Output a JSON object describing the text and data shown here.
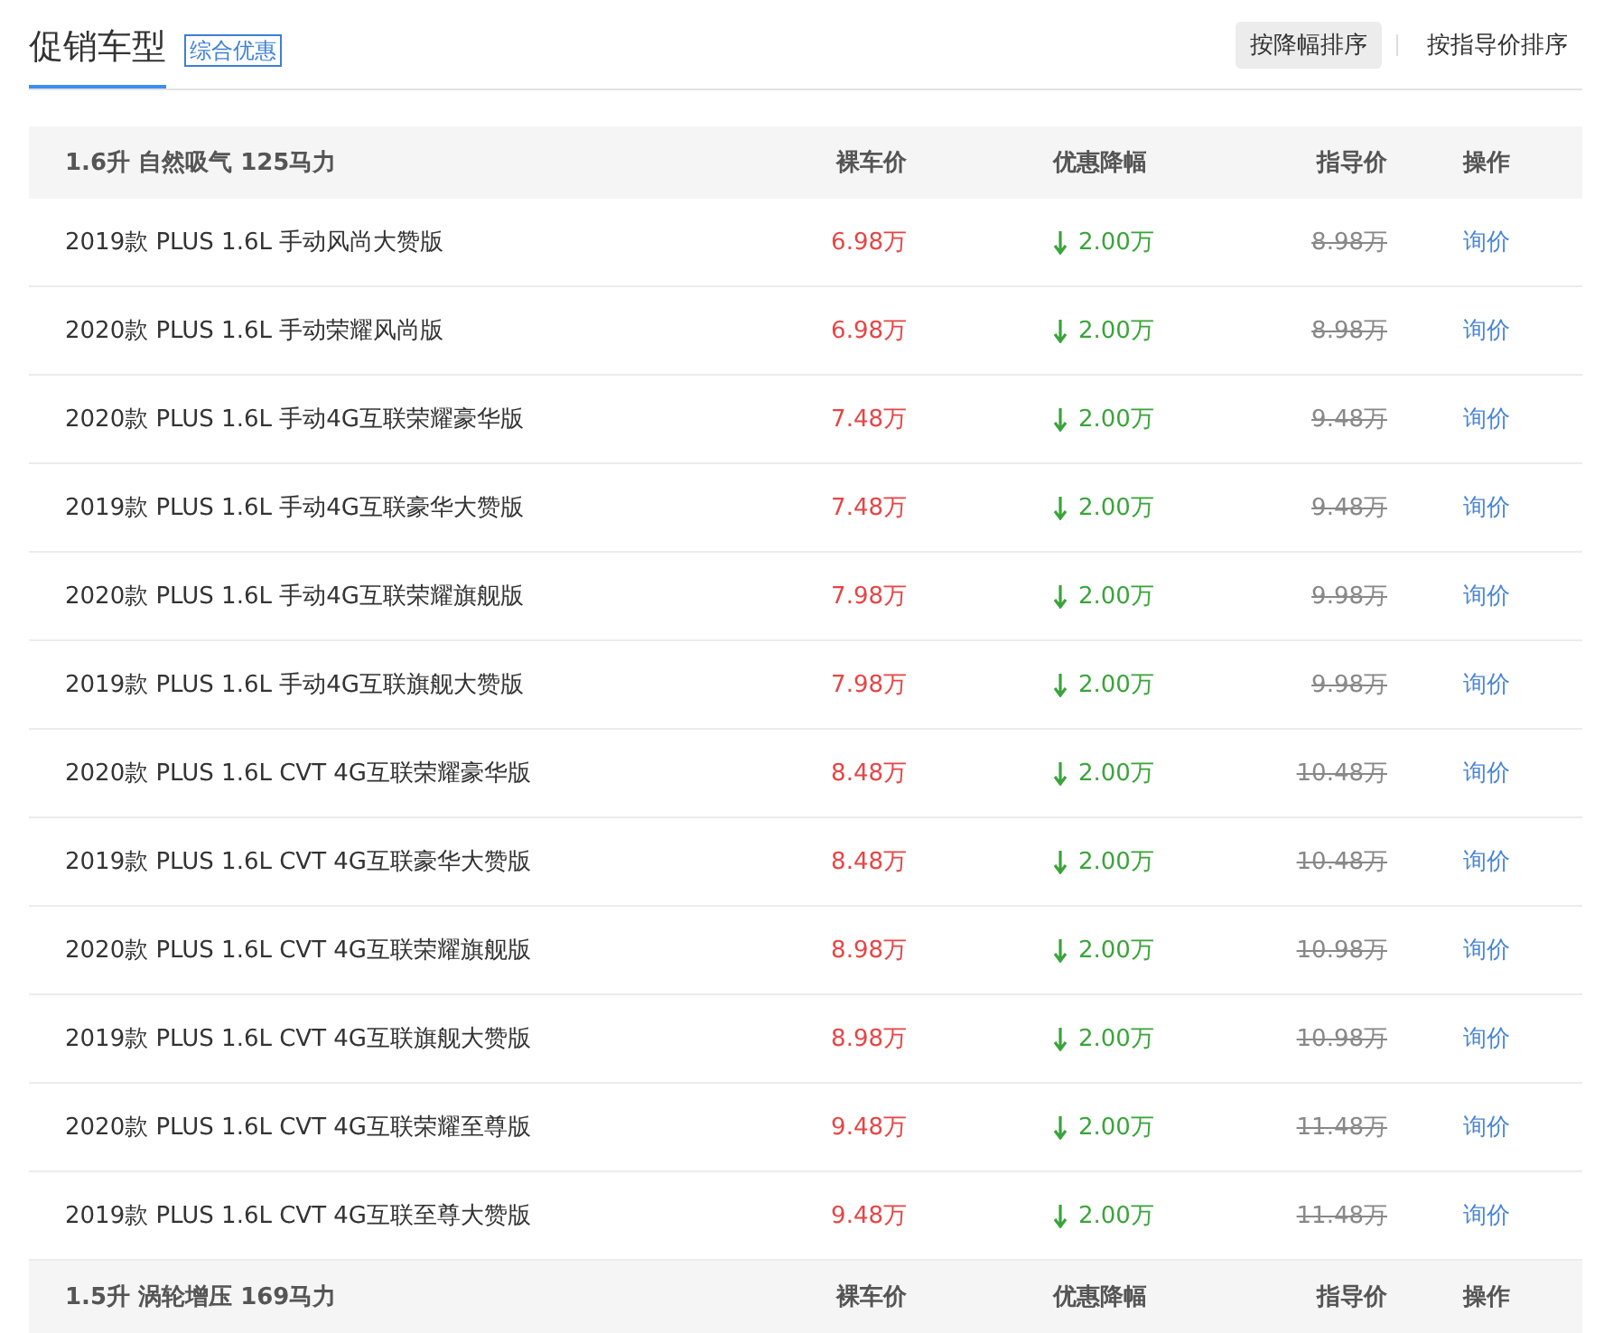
{
  "header": {
    "title": "促销车型",
    "badge": "综合优惠",
    "sort_options": [
      {
        "label": "按降幅排序",
        "selected": true
      },
      {
        "label": "按指导价排序",
        "selected": false
      }
    ]
  },
  "groups": [
    {
      "title": "1.6升 自然吸气 125马力",
      "columns": [
        "裸车价",
        "优惠降幅",
        "指导价",
        "操作"
      ],
      "rows": [
        {
          "name": "2019款 PLUS 1.6L 手动风尚大赞版",
          "price": "6.98万",
          "discount": "2.00万",
          "guide": "8.98万",
          "action": "询价"
        },
        {
          "name": "2020款 PLUS 1.6L 手动荣耀风尚版",
          "price": "6.98万",
          "discount": "2.00万",
          "guide": "8.98万",
          "action": "询价"
        },
        {
          "name": "2020款 PLUS 1.6L 手动4G互联荣耀豪华版",
          "price": "7.48万",
          "discount": "2.00万",
          "guide": "9.48万",
          "action": "询价"
        },
        {
          "name": "2019款 PLUS 1.6L 手动4G互联豪华大赞版",
          "price": "7.48万",
          "discount": "2.00万",
          "guide": "9.48万",
          "action": "询价"
        },
        {
          "name": "2020款 PLUS 1.6L 手动4G互联荣耀旗舰版",
          "price": "7.98万",
          "discount": "2.00万",
          "guide": "9.98万",
          "action": "询价"
        },
        {
          "name": "2019款 PLUS 1.6L 手动4G互联旗舰大赞版",
          "price": "7.98万",
          "discount": "2.00万",
          "guide": "9.98万",
          "action": "询价"
        },
        {
          "name": "2020款 PLUS 1.6L CVT 4G互联荣耀豪华版",
          "price": "8.48万",
          "discount": "2.00万",
          "guide": "10.48万",
          "action": "询价"
        },
        {
          "name": "2019款 PLUS 1.6L CVT 4G互联豪华大赞版",
          "price": "8.48万",
          "discount": "2.00万",
          "guide": "10.48万",
          "action": "询价"
        },
        {
          "name": "2020款 PLUS 1.6L CVT 4G互联荣耀旗舰版",
          "price": "8.98万",
          "discount": "2.00万",
          "guide": "10.98万",
          "action": "询价"
        },
        {
          "name": "2019款 PLUS 1.6L CVT 4G互联旗舰大赞版",
          "price": "8.98万",
          "discount": "2.00万",
          "guide": "10.98万",
          "action": "询价"
        },
        {
          "name": "2020款 PLUS 1.6L CVT 4G互联荣耀至尊版",
          "price": "9.48万",
          "discount": "2.00万",
          "guide": "11.48万",
          "action": "询价"
        },
        {
          "name": "2019款 PLUS 1.6L CVT 4G互联至尊大赞版",
          "price": "9.48万",
          "discount": "2.00万",
          "guide": "11.48万",
          "action": "询价"
        }
      ]
    },
    {
      "title": "1.5升 涡轮增压 169马力",
      "columns": [
        "裸车价",
        "优惠降幅",
        "指导价",
        "操作"
      ]
    }
  ]
}
